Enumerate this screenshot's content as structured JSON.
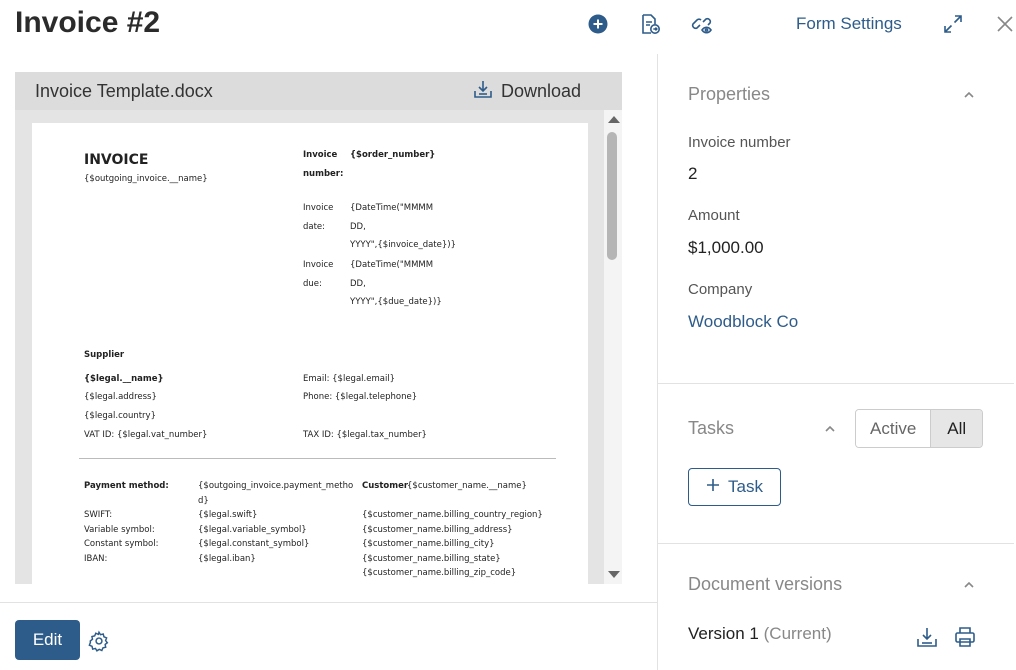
{
  "header": {
    "title": "Invoice #2",
    "form_settings_label": "Form Settings"
  },
  "viewer": {
    "file_name": "Invoice Template.docx",
    "download_label": "Download"
  },
  "document": {
    "heading": "INVOICE",
    "outgoing_name": "{$outgoing_invoice.__name}",
    "invoice_number_label_1": "Invoice",
    "invoice_number_label_2": "number:",
    "order_number": "{$order_number}",
    "invoice_date_label_1": "Invoice",
    "invoice_date_label_2": "date:",
    "invoice_date_1": "{DateTime(\"MMMM",
    "invoice_date_2": "DD,",
    "invoice_date_3": "YYYY\",{$invoice_date})}",
    "invoice_due_label_1": "Invoice",
    "invoice_due_label_2": "due:",
    "invoice_due_1": "{DateTime(\"MMMM",
    "invoice_due_2": "DD,",
    "invoice_due_3": "YYYY\",{$due_date})}",
    "supplier_heading": "Supplier",
    "legal_name": "{$legal.__name}",
    "legal_address": "{$legal.address}",
    "legal_country": "{$legal.country}",
    "vat_id": "VAT ID: {$legal.vat_number}",
    "email": "Email: {$legal.email}",
    "phone": "Phone: {$legal.telephone}",
    "tax_id": "TAX ID: {$legal.tax_number}",
    "payment_method_label": "Payment method:",
    "payment_method_value_1": "{$outgoing_invoice.payment_metho",
    "payment_method_value_2": "d}",
    "swift_label": "SWIFT:",
    "swift_value": "{$legal.swift}",
    "variable_symbol_label": "Variable symbol:",
    "variable_symbol_value": "{$legal.variable_symbol}",
    "constant_symbol_label": "Constant symbol:",
    "constant_symbol_value": "{$legal.constant_symbol}",
    "iban_label": "IBAN:",
    "iban_value": "{$legal.iban}",
    "customer_label": "Customer",
    "customer_name": "{$customer_name.__name}",
    "billing_country": "{$customer_name.billing_country_region}",
    "billing_address": "{$customer_name.billing_address}",
    "billing_city": "{$customer_name.billing_city}",
    "billing_state": "{$customer_name.billing_state}",
    "billing_zip": "{$customer_name.billing_zip_code}"
  },
  "footer": {
    "edit_label": "Edit"
  },
  "properties": {
    "title": "Properties",
    "invoice_number_label": "Invoice number",
    "invoice_number_value": "2",
    "amount_label": "Amount",
    "amount_value": "$1,000.00",
    "company_label": "Company",
    "company_value": "Woodblock Co"
  },
  "tasks": {
    "title": "Tasks",
    "filter_active": "Active",
    "filter_all": "All",
    "add_task_label": "Task"
  },
  "versions": {
    "title": "Document versions",
    "version_label": "Version 1",
    "current_label": "(Current)"
  },
  "colors": {
    "accent": "#2e5c8a",
    "muted": "#888888"
  }
}
